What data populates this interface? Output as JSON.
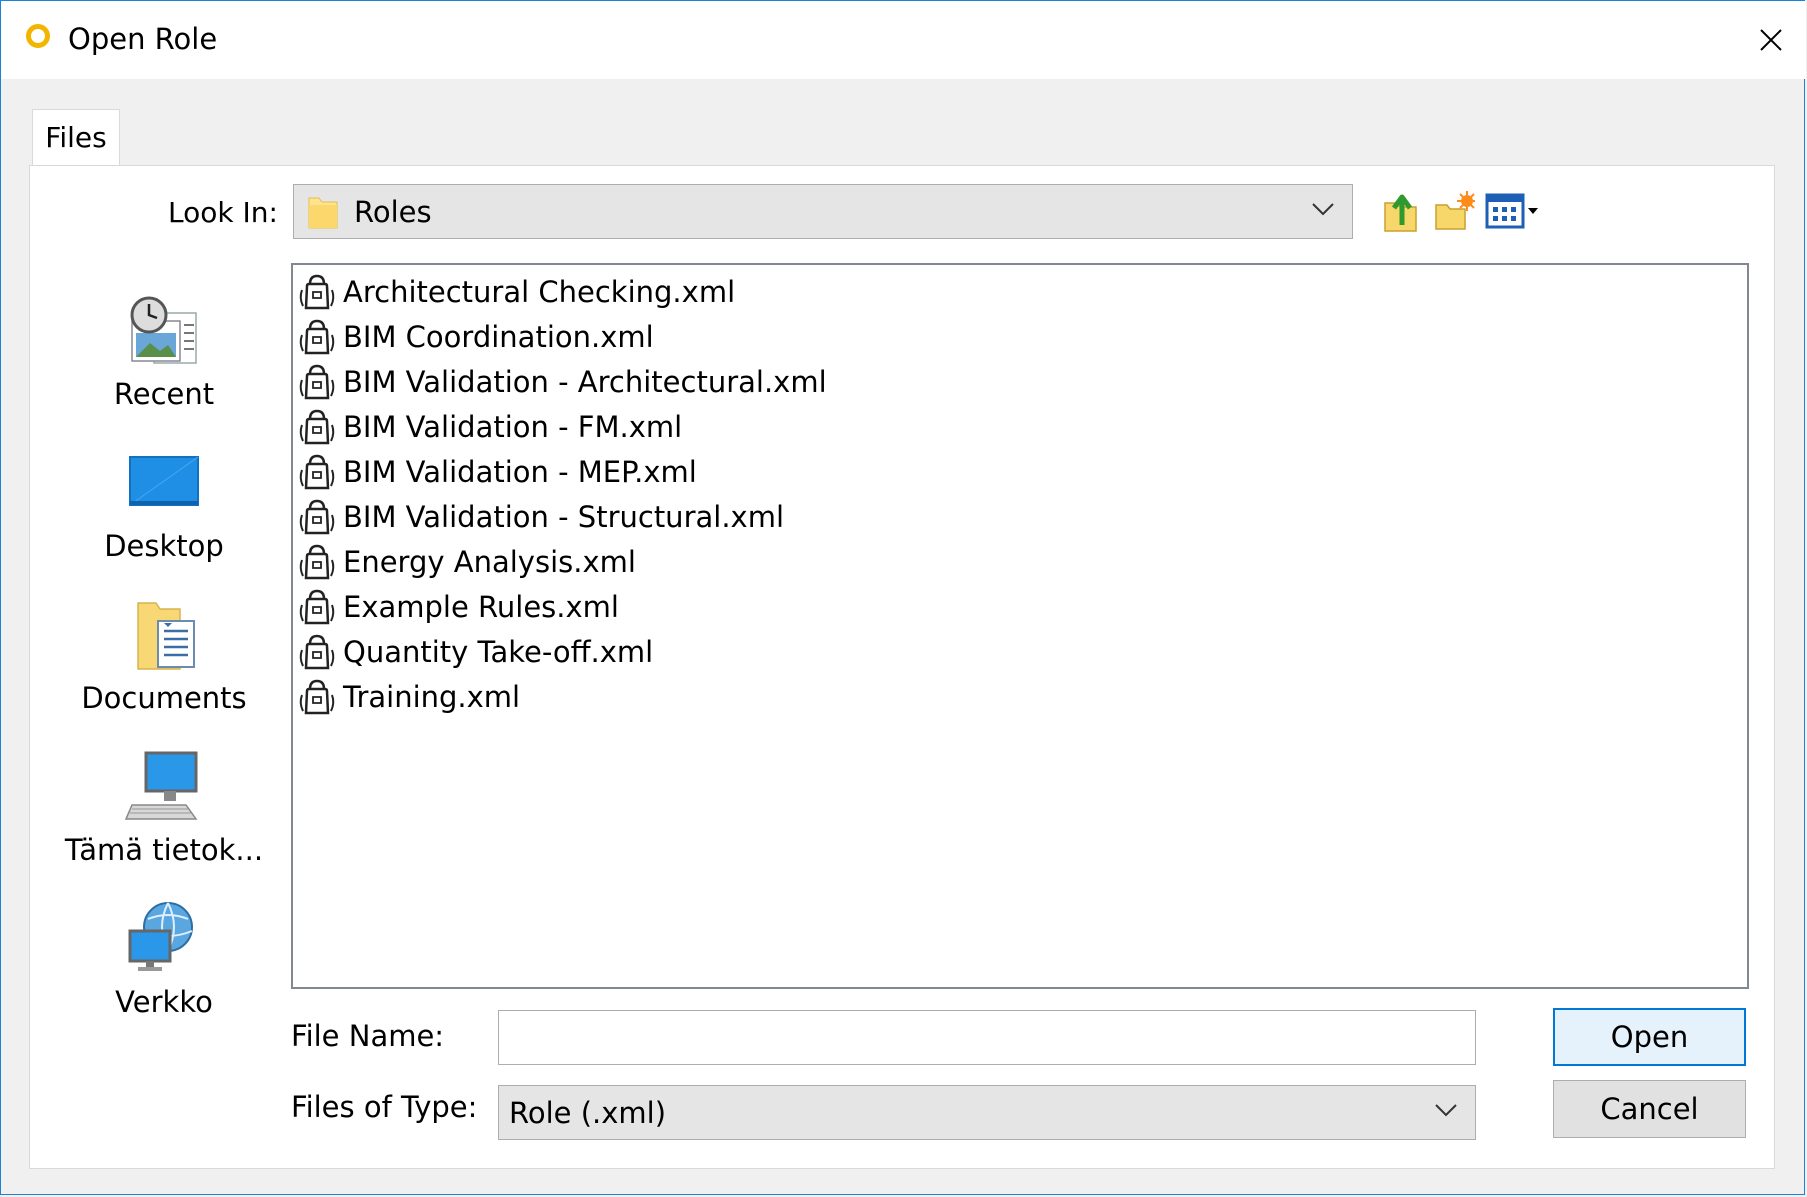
{
  "window": {
    "title": "Open Role"
  },
  "tabs": [
    {
      "label": "Files"
    }
  ],
  "look_in": {
    "label": "Look In:",
    "value": "Roles"
  },
  "toolbar": {
    "icons": [
      "up-one-level-icon",
      "create-new-folder-icon",
      "view-menu-icon"
    ]
  },
  "places": [
    {
      "label": "Recent",
      "icon": "recent-icon"
    },
    {
      "label": "Desktop",
      "icon": "desktop-icon"
    },
    {
      "label": "Documents",
      "icon": "documents-icon"
    },
    {
      "label": "Tämä tietok...",
      "icon": "computer-icon"
    },
    {
      "label": "Verkko",
      "icon": "network-icon"
    }
  ],
  "files": [
    {
      "name": "Architectural Checking.xml"
    },
    {
      "name": "BIM Coordination.xml"
    },
    {
      "name": "BIM Validation - Architectural.xml"
    },
    {
      "name": "BIM Validation - FM.xml"
    },
    {
      "name": "BIM Validation - MEP.xml"
    },
    {
      "name": "BIM Validation - Structural.xml"
    },
    {
      "name": "Energy Analysis.xml"
    },
    {
      "name": "Example Rules.xml"
    },
    {
      "name": "Quantity Take-off.xml"
    },
    {
      "name": "Training.xml"
    }
  ],
  "file_name": {
    "label": "File Name:",
    "value": ""
  },
  "file_type": {
    "label": "Files of Type:",
    "value": "Role (.xml)"
  },
  "buttons": {
    "open": "Open",
    "cancel": "Cancel"
  },
  "colors": {
    "accent": "#0078d7",
    "app_icon": "#f2b600"
  }
}
